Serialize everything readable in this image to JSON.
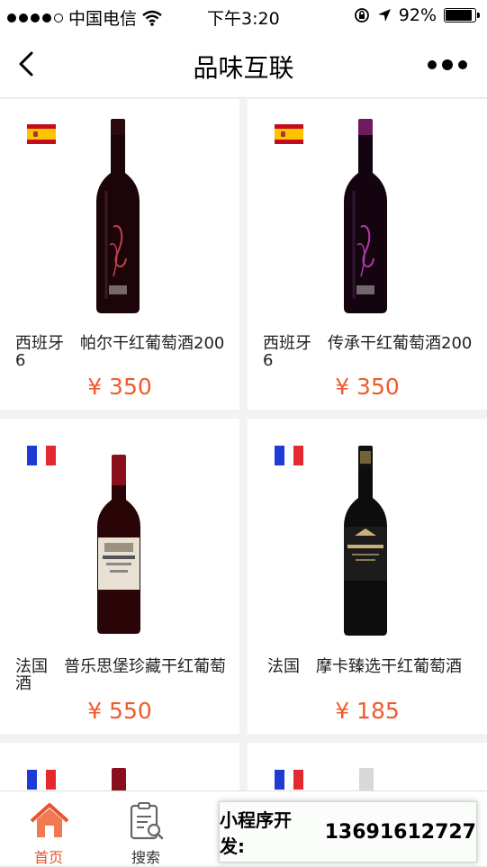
{
  "status_bar": {
    "carrier": "中国电信",
    "time": "下午3:20",
    "battery": "92%",
    "battery_level": 0.92
  },
  "navbar": {
    "title": "品味互联",
    "back_icon": "chevron-left-icon",
    "more_icon": "more-dots-icon"
  },
  "products": [
    {
      "flag": "spain",
      "name": "西班牙　帕尔干红葡萄酒2006",
      "price": "¥ 350",
      "label_color": "#c0404f"
    },
    {
      "flag": "spain",
      "name": "西班牙　传承干红葡萄酒2006",
      "price": "¥ 350",
      "label_color": "#b13aa8"
    },
    {
      "flag": "france",
      "name": "法国　普乐思堡珍藏干红葡萄酒",
      "price": "¥ 550",
      "label_color": "#e8e0d2"
    },
    {
      "flag": "france",
      "name": "法国　摩卡臻选干红葡萄酒",
      "price": "¥ 185",
      "label_color": "#1c1c1c"
    },
    {
      "flag": "france"
    },
    {
      "flag": "france"
    }
  ],
  "tabbar": {
    "tabs": [
      {
        "label": "首页",
        "icon": "home-icon",
        "active": true
      },
      {
        "label": "搜索",
        "icon": "search-list-icon",
        "active": false
      }
    ]
  },
  "overlay": {
    "label": "小程序开发:",
    "phone": "13691612727"
  },
  "colors": {
    "price": "#f05a2b",
    "active_tab": "#e8542d"
  }
}
